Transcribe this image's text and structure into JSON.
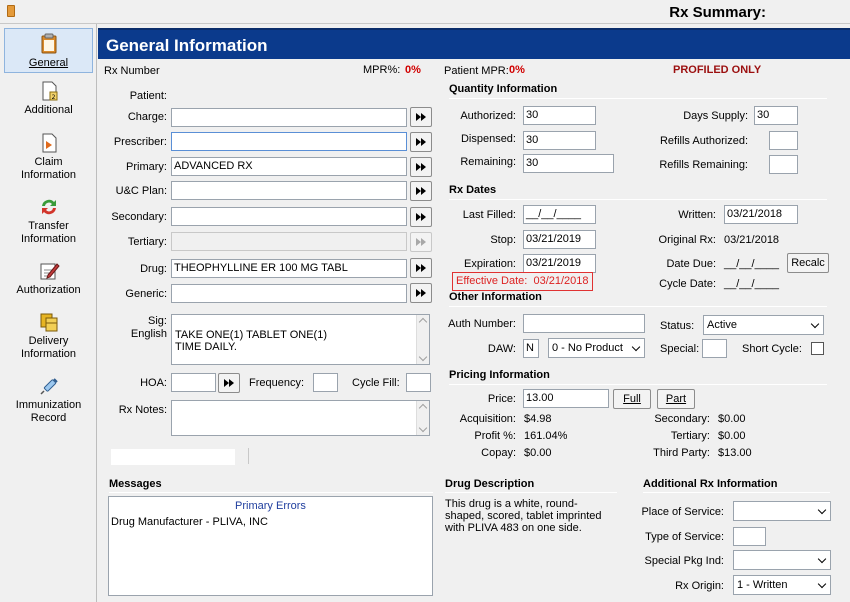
{
  "window": {
    "title": "Rx Summary:"
  },
  "sidebar": {
    "items": [
      {
        "label": "General",
        "icon": "clipboard-icon"
      },
      {
        "label": "Additional",
        "icon": "document-icon"
      },
      {
        "label": "Claim Information",
        "icon": "claim-icon"
      },
      {
        "label": "Transfer Information",
        "icon": "transfer-icon"
      },
      {
        "label": "Authorization",
        "icon": "authorization-icon"
      },
      {
        "label": "Delivery Information",
        "icon": "delivery-icon"
      },
      {
        "label": "Immunization Record",
        "icon": "syringe-icon"
      }
    ]
  },
  "header": {
    "title": "General Information"
  },
  "rx_line": {
    "rx_number_label": "Rx Number",
    "mpr_label": "MPR%:",
    "mpr_value": "0%",
    "patient_mpr_label": "Patient MPR:",
    "patient_mpr_value": "0%",
    "profiled": "PROFILED ONLY"
  },
  "left": {
    "patient_label": "Patient:",
    "charge_label": "Charge:",
    "charge_value": "",
    "prescriber_label": "Prescriber:",
    "prescriber_value": "",
    "primary_label": "Primary:",
    "primary_value": "ADVANCED RX",
    "uc_plan_label": "U&C Plan:",
    "uc_plan_value": "",
    "secondary_label": "Secondary:",
    "secondary_value": "",
    "tertiary_label": "Tertiary:",
    "tertiary_value": "",
    "drug_label": "Drug:",
    "drug_value": "THEOPHYLLINE ER 100 MG TABL",
    "generic_label": "Generic:",
    "generic_value": "",
    "sig_label": "Sig:",
    "sig_sublabel": "English",
    "sig_value": "TAKE ONE(1) TABLET ONE(1)\nTIME DAILY.",
    "hoa_label": "HOA:",
    "hoa_value": "",
    "frequency_label": "Frequency:",
    "frequency_value": "",
    "cycle_fill_label": "Cycle Fill:",
    "cycle_fill_value": "",
    "rx_notes_label": "Rx Notes:",
    "rx_notes_value": ""
  },
  "quantity": {
    "title": "Quantity Information",
    "authorized_label": "Authorized:",
    "authorized_value": "30",
    "dispensed_label": "Dispensed:",
    "dispensed_value": "30",
    "remaining_label": "Remaining:",
    "remaining_value": "30",
    "days_supply_label": "Days Supply:",
    "days_supply_value": "30",
    "refills_authorized_label": "Refills Authorized:",
    "refills_authorized_value": "",
    "refills_remaining_label": "Refills Remaining:",
    "refills_remaining_value": ""
  },
  "rx_dates": {
    "title": "Rx Dates",
    "last_filled_label": "Last Filled:",
    "last_filled_value": "__/__/____",
    "stop_label": "Stop:",
    "stop_value": "03/21/2019",
    "expiration_label": "Expiration:",
    "expiration_value": "03/21/2019",
    "effective_label": "Effective Date:",
    "effective_value": "03/21/2018",
    "written_label": "Written:",
    "written_value": "03/21/2018",
    "original_rx_label": "Original Rx:",
    "original_rx_value": "03/21/2018",
    "date_due_label": "Date Due:",
    "date_due_value": "__/__/____",
    "recalc_label": "Recalc",
    "cycle_date_label": "Cycle Date:",
    "cycle_date_value": "__/__/____"
  },
  "other": {
    "title": "Other Information",
    "auth_number_label": "Auth Number:",
    "auth_number_value": "",
    "status_label": "Status:",
    "status_value": "Active",
    "daw_label": "DAW:",
    "daw_code": "N",
    "daw_value": "0 - No Product",
    "special_label": "Special:",
    "special_value": "",
    "short_cycle_label": "Short Cycle:"
  },
  "pricing": {
    "title": "Pricing Information",
    "price_label": "Price:",
    "price_value": "13.00",
    "full_label": "Full",
    "part_label": "Part",
    "acquisition_label": "Acquisition:",
    "acquisition_value": "$4.98",
    "profit_label": "Profit %:",
    "profit_value": "161.04%",
    "copay_label": "Copay:",
    "copay_value": "$0.00",
    "secondary_label": "Secondary:",
    "secondary_value": "$0.00",
    "tertiary_label": "Tertiary:",
    "tertiary_value": "$0.00",
    "third_party_label": "Third Party:",
    "third_party_value": "$13.00"
  },
  "messages": {
    "title": "Messages",
    "header": "Primary Errors",
    "text": "Drug Manufacturer - PLIVA, INC"
  },
  "drug_description": {
    "title": "Drug Description",
    "text": "This drug is a white, round-shaped, scored, tablet imprinted with PLIVA  483 on one side."
  },
  "additional_rx": {
    "title": "Additional Rx Information",
    "place_label": "Place of Service:",
    "place_value": "",
    "type_label": "Type of Service:",
    "type_value": "",
    "special_pkg_label": "Special Pkg Ind:",
    "special_pkg_value": "",
    "origin_label": "Rx Origin:",
    "origin_value": "1 - Written"
  }
}
